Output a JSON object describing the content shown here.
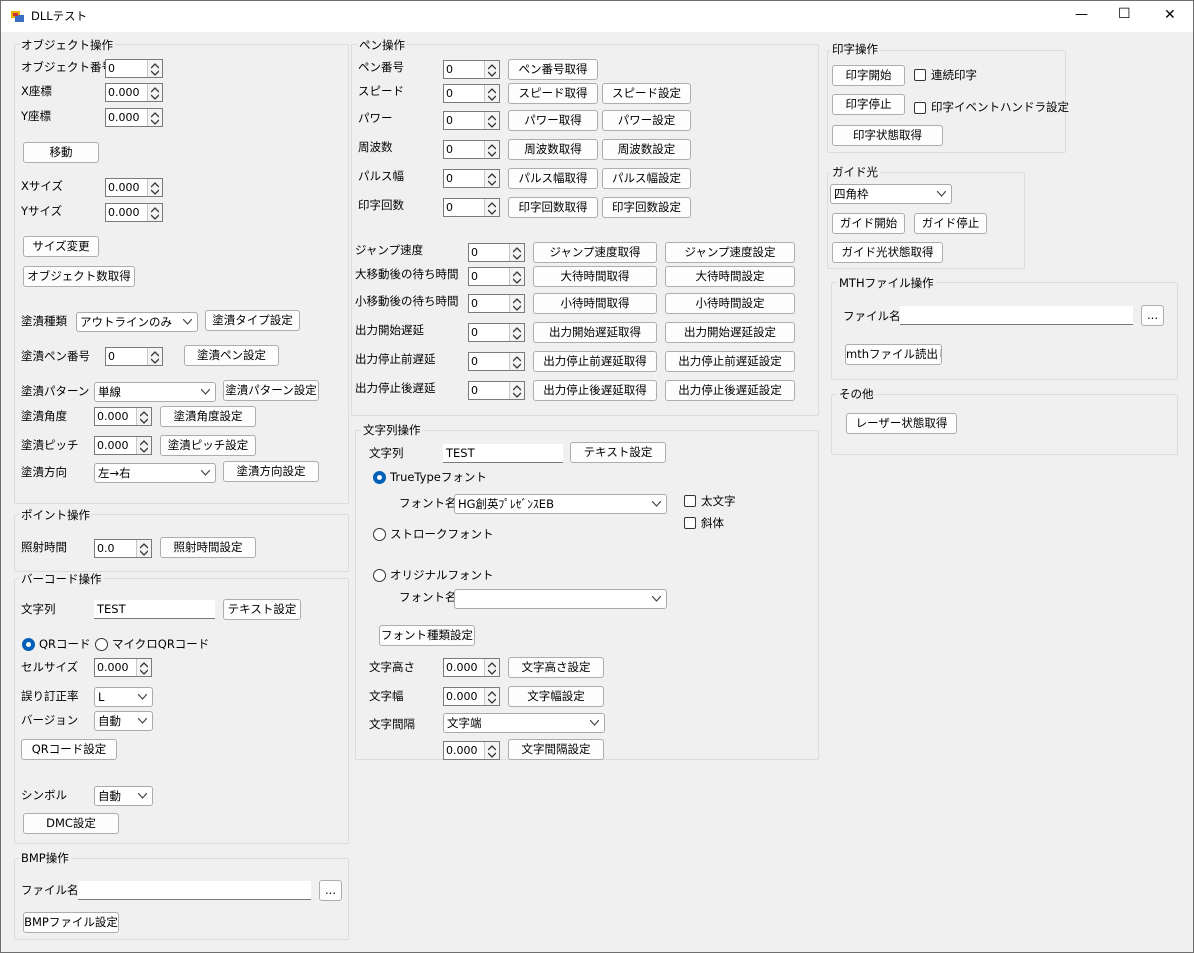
{
  "window": {
    "title": "DLLテスト",
    "minimize": "—",
    "maximize": "☐",
    "close": "✕"
  },
  "object_ops": {
    "title": "オブジェクト操作",
    "obj_no_label": "オブジェクト番号",
    "obj_no": "0",
    "x_label": "X座標",
    "x": "0.000",
    "y_label": "Y座標",
    "y": "0.000",
    "move": "移動",
    "xsize_label": "Xサイズ",
    "xsize": "0.000",
    "ysize_label": "Yサイズ",
    "ysize": "0.000",
    "resize": "サイズ変更",
    "get_count": "オブジェクト数取得",
    "fill_type_label": "塗潰種類",
    "fill_type": "アウトラインのみ",
    "fill_type_btn": "塗潰タイプ設定",
    "fill_pen_label": "塗潰ペン番号",
    "fill_pen": "0",
    "fill_pen_btn": "塗潰ペン設定",
    "pattern_label": "塗潰パターン",
    "pattern": "単線",
    "pattern_btn": "塗潰パターン設定",
    "angle_label": "塗潰角度",
    "angle": "0.000",
    "angle_btn": "塗潰角度設定",
    "pitch_label": "塗潰ピッチ",
    "pitch": "0.000",
    "pitch_btn": "塗潰ピッチ設定",
    "dir_label": "塗潰方向",
    "dir": "左→右",
    "dir_btn": "塗潰方向設定"
  },
  "point_ops": {
    "title": "ポイント操作",
    "time_label": "照射時間",
    "time": "0.0",
    "time_btn": "照射時間設定"
  },
  "barcode_ops": {
    "title": "バーコード操作",
    "text_label": "文字列",
    "text": "TEST",
    "text_btn": "テキスト設定",
    "qr": "QRコード",
    "micro_qr": "マイクロQRコード",
    "cell_label": "セルサイズ",
    "cell": "0.000",
    "ecc_label": "誤り訂正率",
    "ecc": "L",
    "ver_label": "バージョン",
    "ver": "自動",
    "qr_btn": "QRコード設定",
    "sym_label": "シンボル",
    "sym": "自動",
    "dmc_btn": "DMC設定"
  },
  "bmp_ops": {
    "title": "BMP操作",
    "file_label": "ファイル名",
    "file": "",
    "browse": "...",
    "set_btn": "BMPファイル設定"
  },
  "pen_ops": {
    "title": "ペン操作",
    "rows": [
      {
        "label": "ペン番号",
        "value": "0",
        "get": "ペン番号取得",
        "set": ""
      },
      {
        "label": "スピード",
        "value": "0",
        "get": "スピード取得",
        "set": "スピード設定"
      },
      {
        "label": "パワー",
        "value": "0",
        "get": "パワー取得",
        "set": "パワー設定"
      },
      {
        "label": "周波数",
        "value": "0",
        "get": "周波数取得",
        "set": "周波数設定"
      },
      {
        "label": "パルス幅",
        "value": "0",
        "get": "パルス幅取得",
        "set": "パルス幅設定"
      },
      {
        "label": "印字回数",
        "value": "0",
        "get": "印字回数取得",
        "set": "印字回数設定"
      }
    ],
    "rows2": [
      {
        "label": "ジャンプ速度",
        "value": "0",
        "get": "ジャンプ速度取得",
        "set": "ジャンプ速度設定"
      },
      {
        "label": "大移動後の待ち時間",
        "value": "0",
        "get": "大待時間取得",
        "set": "大待時間設定"
      },
      {
        "label": "小移動後の待ち時間",
        "value": "0",
        "get": "小待時間取得",
        "set": "小待時間設定"
      },
      {
        "label": "出力開始遅延",
        "value": "0",
        "get": "出力開始遅延取得",
        "set": "出力開始遅延設定"
      },
      {
        "label": "出力停止前遅延",
        "value": "0",
        "get": "出力停止前遅延取得",
        "set": "出力停止前遅延設定"
      },
      {
        "label": "出力停止後遅延",
        "value": "0",
        "get": "出力停止後遅延取得",
        "set": "出力停止後遅延設定"
      }
    ]
  },
  "string_ops": {
    "title": "文字列操作",
    "text_label": "文字列",
    "text": "TEST",
    "text_btn": "テキスト設定",
    "truetype": "TrueTypeフォント",
    "font_label": "フォント名",
    "font": "HG創英ﾌﾟﾚｾﾞﾝｽEB",
    "bold": "太文字",
    "italic": "斜体",
    "stroke": "ストロークフォント",
    "original": "オリジナルフォント",
    "font2_label": "フォント名",
    "font2": "",
    "font_type_btn": "フォント種類設定",
    "height_label": "文字高さ",
    "height": "0.000",
    "height_btn": "文字高さ設定",
    "width_label": "文字幅",
    "width": "0.000",
    "width_btn": "文字幅設定",
    "spacing_label": "文字間隔",
    "spacing": "文字端",
    "spacing_val": "0.000",
    "spacing_btn": "文字間隔設定"
  },
  "print_ops": {
    "title": "印字操作",
    "start": "印字開始",
    "continuous": "連続印字",
    "stop": "印字停止",
    "event": "印字イベントハンドラ設定",
    "status": "印字状態取得"
  },
  "guide_ops": {
    "title": "ガイド光",
    "shape": "四角枠",
    "start": "ガイド開始",
    "stop": "ガイド停止",
    "status": "ガイド光状態取得"
  },
  "mth_ops": {
    "title": "MTHファイル操作",
    "file_label": "ファイル名",
    "file": "",
    "browse": "...",
    "read_btn": "mthファイル読出し"
  },
  "other_ops": {
    "title": "その他",
    "laser_btn": "レーザー状態取得"
  }
}
